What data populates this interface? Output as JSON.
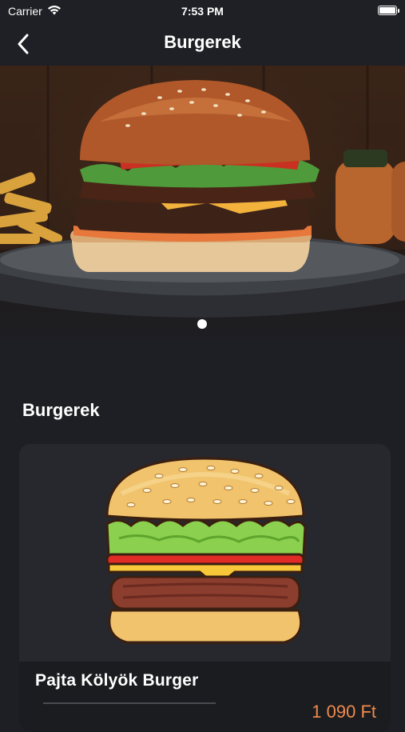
{
  "status_bar": {
    "carrier": "Carrier",
    "time": "7:53 PM"
  },
  "nav": {
    "title": "Burgerek"
  },
  "hero": {
    "page_count": 1,
    "active_page": 1
  },
  "section": {
    "title": "Burgerek"
  },
  "product": {
    "name": "Pajta Kölyök Burger",
    "price": "1 090 Ft"
  },
  "colors": {
    "background": "#1e1f24",
    "card": "#27282d",
    "price_accent": "#f08a4b"
  }
}
